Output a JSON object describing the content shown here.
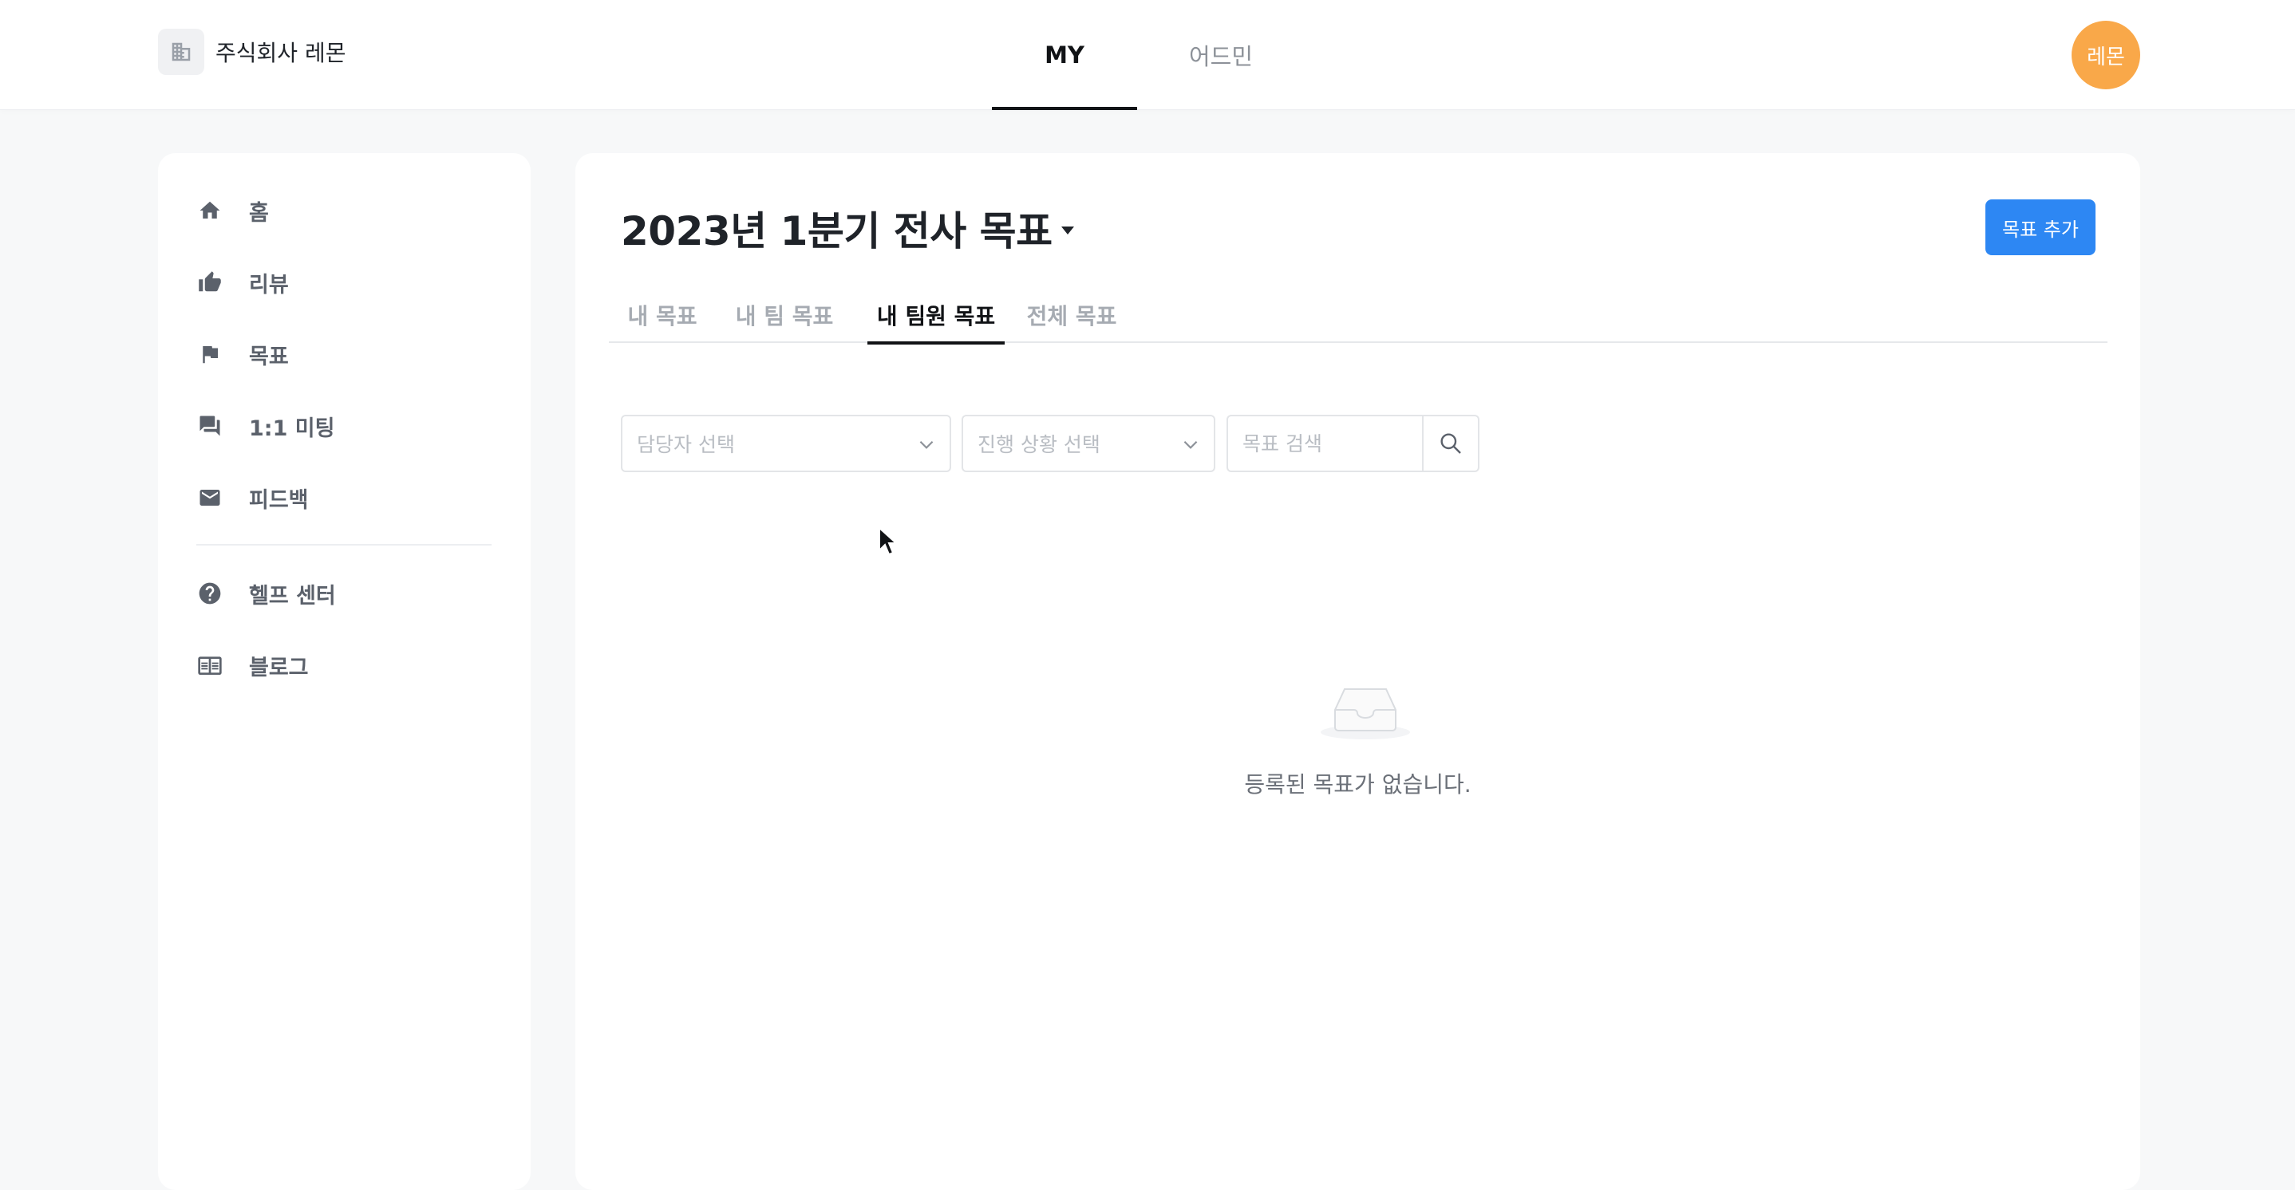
{
  "header": {
    "company_name": "주식회사 레몬",
    "nav": [
      {
        "label": "MY",
        "active": true
      },
      {
        "label": "어드민",
        "active": false
      }
    ],
    "avatar_text": "레몬",
    "avatar_color": "#f9a849"
  },
  "sidebar": {
    "items": [
      {
        "label": "홈",
        "icon": "home-icon"
      },
      {
        "label": "리뷰",
        "icon": "thumbs-up-icon"
      },
      {
        "label": "목표",
        "icon": "flag-icon"
      },
      {
        "label": "1:1 미팅",
        "icon": "chat-icon"
      },
      {
        "label": "피드백",
        "icon": "mail-icon"
      }
    ],
    "secondary_items": [
      {
        "label": "헬프 센터",
        "icon": "help-icon"
      },
      {
        "label": "블로그",
        "icon": "book-icon"
      }
    ]
  },
  "main": {
    "title": "2023년 1분기 전사 목표",
    "add_button": "목표 추가",
    "tabs": [
      {
        "label": "내 목표",
        "active": false
      },
      {
        "label": "내 팀 목표",
        "active": false
      },
      {
        "label": "내 팀원 목표",
        "active": true
      },
      {
        "label": "전체 목표",
        "active": false
      }
    ],
    "filters": {
      "assignee_placeholder": "담당자 선택",
      "status_placeholder": "진행 상황 선택",
      "search_placeholder": "목표 검색"
    },
    "empty_message": "등록된 목표가 없습니다."
  },
  "colors": {
    "accent": "#2d87f3",
    "avatar": "#f9a849",
    "background": "#f7f8f9"
  }
}
